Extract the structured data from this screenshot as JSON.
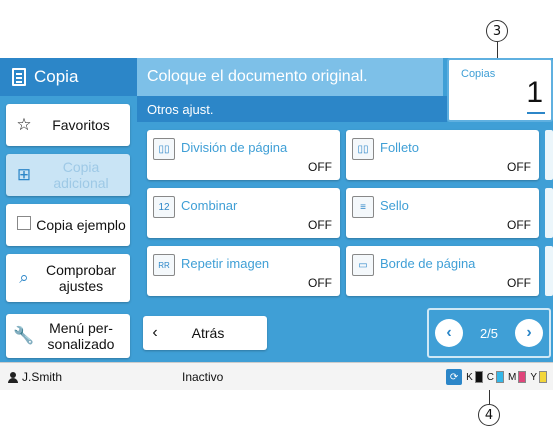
{
  "callouts": {
    "top": "3",
    "bottom": "4"
  },
  "app": {
    "title": "Copia"
  },
  "header": {
    "message": "Coloque el documento original.",
    "copies_label": "Copias",
    "copies_value": "1"
  },
  "subheader": {
    "title": "Otros ajust."
  },
  "sidebar": {
    "favorites": "Favoritos",
    "additional_copy": "Copia adicional",
    "sample_copy": "Copia ejemplo",
    "check_settings": "Comprobar ajustes",
    "custom_menu": "Menú per-sonalizado"
  },
  "functions": [
    {
      "label": "División de página",
      "value": "OFF"
    },
    {
      "label": "Folleto",
      "value": "OFF"
    },
    {
      "label": "Combinar",
      "value": "OFF"
    },
    {
      "label": "Sello",
      "value": "OFF"
    },
    {
      "label": "Repetir imagen",
      "value": "OFF"
    },
    {
      "label": "Borde de página",
      "value": "OFF"
    }
  ],
  "nav": {
    "back": "Atrás",
    "page": "2/5"
  },
  "status": {
    "user": "J.Smith",
    "state": "Inactivo",
    "inks": [
      {
        "letter": "K",
        "color": "#111111"
      },
      {
        "letter": "C",
        "color": "#35b7e8"
      },
      {
        "letter": "M",
        "color": "#e0457b"
      },
      {
        "letter": "Y",
        "color": "#f3d63b"
      }
    ]
  }
}
